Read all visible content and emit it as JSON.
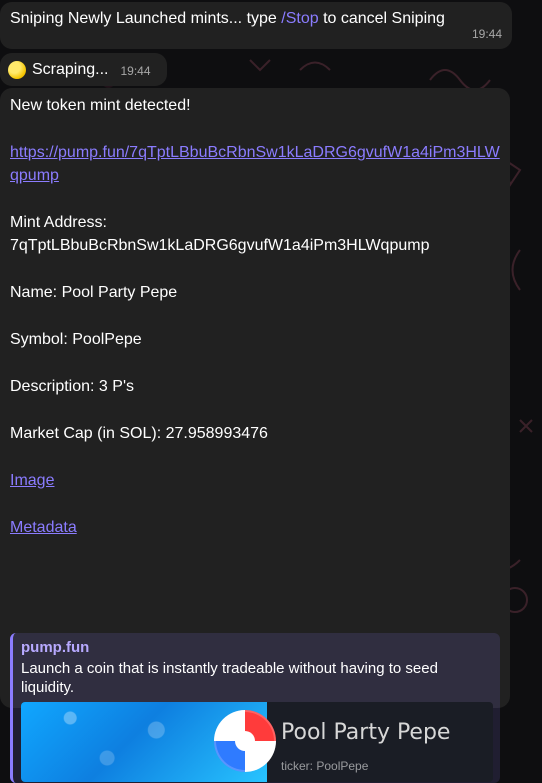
{
  "messages": {
    "m1": {
      "text_pre": "Sniping Newly Launched mints... type ",
      "command": "/Stop",
      "text_post": " to cancel Sniping",
      "time": "19:44"
    },
    "m2": {
      "text": "Scraping...",
      "time": "19:44",
      "emoji_icon": "yellow-circle-emoji"
    },
    "m3": {
      "header": "New token mint detected!",
      "link_url": "https://pump.fun/7qTptLBbuBcRbnSw1kLaDRG6gvufW1a4iPm3HLWqpump",
      "mint_label": "Mint Address:",
      "mint_address": "7qTptLBbuBcRbnSw1kLaDRG6gvufW1a4iPm3HLWqpump",
      "name_line": "Name: Pool Party Pepe",
      "symbol_line": "Symbol: PoolPepe",
      "description_line": "Description: 3 P's",
      "market_cap_line": "Market Cap (in SOL): 27.958993476",
      "image_link": "Image",
      "metadata_link": "Metadata"
    }
  },
  "link_preview": {
    "site_name": "pump.fun",
    "description": "Launch a coin that is instantly tradeable without having to seed liquidity.",
    "card_title": "Pool Party Pepe",
    "card_ticker": "ticker: PoolPepe",
    "image_icon": "beach-ball-icon"
  },
  "colors": {
    "bubble": "#212121",
    "link": "#8b7cff",
    "preview_accent": "#8b7cff"
  }
}
